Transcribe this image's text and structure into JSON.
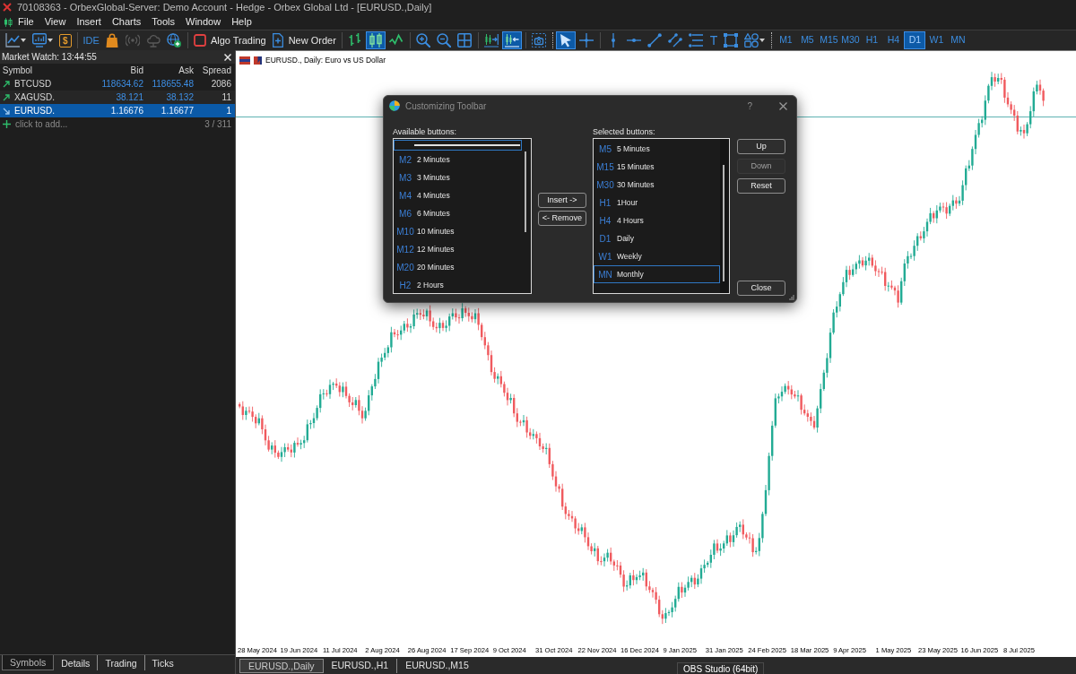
{
  "window": {
    "title": "70108363 - OrbexGlobal-Server: Demo Account - Hedge - Orbex Global Ltd - [EURUSD.,Daily]"
  },
  "menu": [
    "File",
    "View",
    "Insert",
    "Charts",
    "Tools",
    "Window",
    "Help"
  ],
  "toolbar": {
    "market": "$",
    "ide": "IDE",
    "services": [
      {
        "kind": "signals",
        "disabled": true
      },
      {
        "kind": "cloud",
        "disabled": true
      }
    ],
    "algo_trading": "Algo Trading",
    "new_order": "New Order",
    "chart_types": [
      {
        "kind": "bars",
        "selected": false
      },
      {
        "kind": "candles",
        "selected": true
      },
      {
        "kind": "line",
        "selected": false
      }
    ],
    "view_toggles": [
      {
        "kind": "shift",
        "on": false
      },
      {
        "kind": "autoscroll",
        "on": true
      }
    ],
    "pointer_tools": [
      {
        "kind": "cursor",
        "selected": true
      },
      {
        "kind": "crosshair",
        "selected": false
      }
    ],
    "text_tool": "T",
    "timeframes": [
      {
        "label": "M1",
        "selected": false
      },
      {
        "label": "M5",
        "selected": false
      },
      {
        "label": "M15",
        "selected": false
      },
      {
        "label": "M30",
        "selected": false
      },
      {
        "label": "H1",
        "selected": false
      },
      {
        "label": "H4",
        "selected": false
      },
      {
        "label": "D1",
        "selected": true
      },
      {
        "label": "W1",
        "selected": false
      },
      {
        "label": "MN",
        "selected": false
      }
    ]
  },
  "market_watch": {
    "title": "Market Watch: 13:44:55",
    "columns": [
      "Symbol",
      "Bid",
      "Ask",
      "Spread"
    ],
    "rows": [
      {
        "kind": "up",
        "symbol": "BTCUSD",
        "bid": "118634.62",
        "ask": "118655.48",
        "spread": "2086",
        "selected": false
      },
      {
        "kind": "up",
        "symbol": "XAGUSD.",
        "bid": "38.121",
        "ask": "38.132",
        "spread": "11",
        "selected": false
      },
      {
        "kind": "down",
        "symbol": "EURUSD.",
        "bid": "1.16676",
        "ask": "1.16677",
        "spread": "1",
        "selected": true
      }
    ],
    "add_row": {
      "label": "click to add...",
      "count": "3 / 311"
    },
    "tabs": [
      {
        "label": "Symbols",
        "selected": true
      },
      {
        "label": "Details",
        "selected": false
      },
      {
        "label": "Trading",
        "selected": false
      },
      {
        "label": "Ticks",
        "selected": false
      }
    ]
  },
  "chart": {
    "title": "EURUSD., Daily: Euro vs US Dollar",
    "x_axis_labels": [
      "28 May 2024",
      "19 Jun 2024",
      "11 Jul 2024",
      "2 Aug 2024",
      "26 Aug 2024",
      "17 Sep 2024",
      "9 Oct 2024",
      "31 Oct 2024",
      "22 Nov 2024",
      "16 Dec 2024",
      "9 Jan 2025",
      "31 Jan 2025",
      "24 Feb 2025",
      "18 Mar 2025",
      "9 Apr 2025",
      "1 May 2025",
      "23 May 2025",
      "16 Jun 2025",
      "8 Jul 2025"
    ],
    "tabs": [
      {
        "label": "EURUSD.,Daily",
        "selected": true
      },
      {
        "label": "EURUSD.,H1",
        "selected": false
      },
      {
        "label": "EURUSD.,M15",
        "selected": false
      }
    ]
  },
  "dialog": {
    "title": "Customizing Toolbar",
    "help": "?",
    "available_label": "Available buttons:",
    "available": [
      {
        "kind": "separator",
        "selected": true
      },
      {
        "kind": "timeframe",
        "code": "M2",
        "label": "2 Minutes",
        "selected": false
      },
      {
        "kind": "timeframe",
        "code": "M3",
        "label": "3 Minutes",
        "selected": false
      },
      {
        "kind": "timeframe",
        "code": "M4",
        "label": "4 Minutes",
        "selected": false
      },
      {
        "kind": "timeframe",
        "code": "M6",
        "label": "6 Minutes",
        "selected": false
      },
      {
        "kind": "timeframe",
        "code": "M10",
        "label": "10 Minutes",
        "selected": false
      },
      {
        "kind": "timeframe",
        "code": "M12",
        "label": "12 Minutes",
        "selected": false
      },
      {
        "kind": "timeframe",
        "code": "M20",
        "label": "20 Minutes",
        "selected": false
      },
      {
        "kind": "timeframe",
        "code": "H2",
        "label": "2 Hours",
        "selected": false
      }
    ],
    "insert_button": "Insert ->",
    "remove_button": "<- Remove",
    "selected_label": "Selected buttons:",
    "selected_items": [
      {
        "kind": "timeframe",
        "code": "M5",
        "label": "5 Minutes",
        "selected": false
      },
      {
        "kind": "timeframe",
        "code": "M15",
        "label": "15 Minutes",
        "selected": false
      },
      {
        "kind": "timeframe",
        "code": "M30",
        "label": "30 Minutes",
        "selected": false
      },
      {
        "kind": "timeframe",
        "code": "H1",
        "label": "1Hour",
        "selected": false
      },
      {
        "kind": "timeframe",
        "code": "H4",
        "label": "4 Hours",
        "selected": false
      },
      {
        "kind": "timeframe",
        "code": "D1",
        "label": "Daily",
        "selected": false
      },
      {
        "kind": "timeframe",
        "code": "W1",
        "label": "Weekly",
        "selected": false
      },
      {
        "kind": "timeframe",
        "code": "MN",
        "label": "Monthly",
        "selected": true
      }
    ],
    "buttons": [
      {
        "label": "Up",
        "disabled": false
      },
      {
        "label": "Down",
        "disabled": true
      },
      {
        "label": "Reset",
        "disabled": false
      },
      {
        "label": "Close",
        "disabled": false
      }
    ]
  },
  "tooltip": "OBS Studio (64bit)"
}
